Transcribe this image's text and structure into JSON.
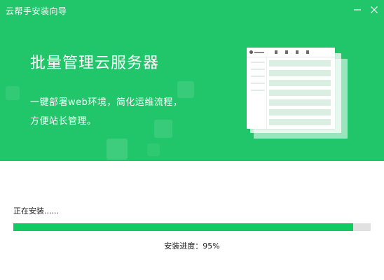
{
  "window": {
    "title": "云帮手安装向导",
    "minimize_icon": "minimize-icon",
    "close_icon": "close-icon"
  },
  "banner": {
    "headline": "批量管理云服务器",
    "description_lines": [
      "一键部署web环境，简化运维流程，",
      "方便站长管理。"
    ],
    "illustration": "server-dashboard-illustration"
  },
  "install": {
    "status_text": "正在安装......",
    "progress_label": "安装进度：95%",
    "progress_percent": 95
  },
  "colors": {
    "brand_green": "#22c66a",
    "progress_fill": "#0fcb62",
    "progress_track": "#e1e1e1"
  }
}
